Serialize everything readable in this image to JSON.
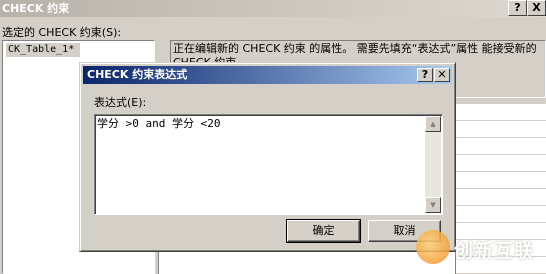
{
  "background": {
    "title": "CHECK 约束",
    "selected_label": "选定的 CHECK 约束(S):",
    "list_items": [
      "CK_Table_1*"
    ],
    "description": "正在编辑新的 CHECK 约束 的属性。 需要先填充“表达式”属性 能接受新的 CHECK 约束。",
    "help_button": "?",
    "close_button": "X"
  },
  "dialog": {
    "title": "CHECK 约束表达式",
    "help_button": "?",
    "close_button": "✕",
    "expression_label": "表达式(E):",
    "expression_value": "学分 >0 and 学分 <20",
    "ok_label": "确定",
    "cancel_label": "取消"
  },
  "watermark": {
    "text": "创新互联"
  }
}
